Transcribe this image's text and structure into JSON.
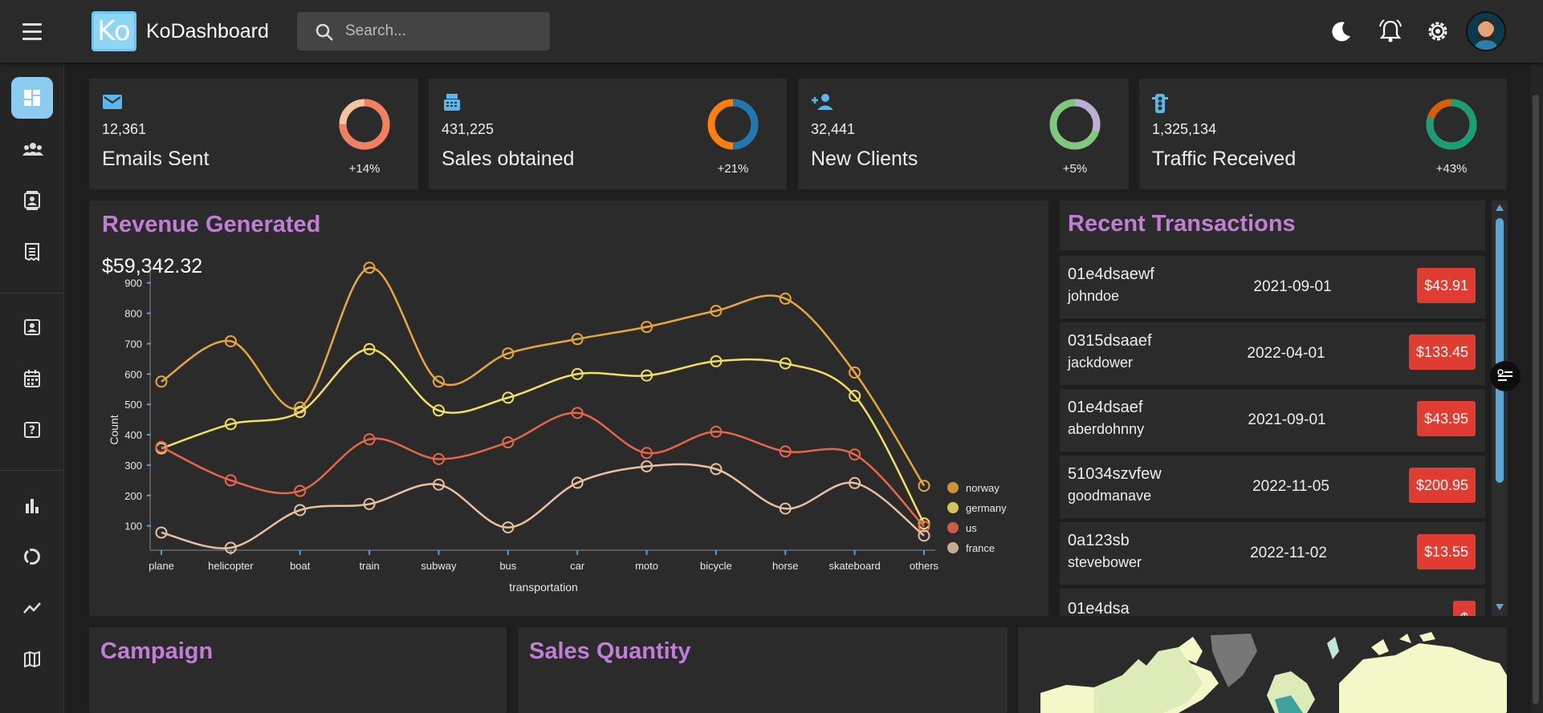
{
  "header": {
    "app_title": "KoDashboard",
    "logo_text": "Ko",
    "search_placeholder": "Search...",
    "icons": [
      "menu-icon",
      "search-icon",
      "moon-icon",
      "bell-icon",
      "gear-icon",
      "avatar"
    ]
  },
  "sidebar": {
    "items": [
      {
        "icon": "dashboard-icon",
        "active": true
      },
      {
        "icon": "team-icon"
      },
      {
        "icon": "contacts-icon"
      },
      {
        "icon": "invoices-icon"
      },
      {
        "icon": "profile-icon"
      },
      {
        "icon": "calendar-icon"
      },
      {
        "icon": "help-icon"
      },
      {
        "icon": "bar-chart-icon"
      },
      {
        "icon": "pie-chart-icon"
      },
      {
        "icon": "line-chart-icon"
      },
      {
        "icon": "map-icon"
      }
    ]
  },
  "stats": [
    {
      "icon": "email-icon",
      "value": "12,361",
      "label": "Emails Sent",
      "increase": "+14%",
      "progress": 0.75,
      "colors": [
        "#f4c6a0",
        "#f08060"
      ]
    },
    {
      "icon": "cash-register-icon",
      "value": "431,225",
      "label": "Sales obtained",
      "increase": "+21%",
      "progress": 0.5,
      "colors": [
        "#ff7f0e",
        "#1f77b4"
      ]
    },
    {
      "icon": "person-add-icon",
      "value": "32,441",
      "label": "New Clients",
      "increase": "+5%",
      "progress": 0.3,
      "colors": [
        "#7fc97f",
        "#beaed4"
      ]
    },
    {
      "icon": "traffic-icon",
      "value": "1,325,134",
      "label": "Traffic Received",
      "increase": "+43%",
      "progress": 0.8,
      "colors": [
        "#d95f02",
        "#1b9e77"
      ]
    }
  ],
  "revenue": {
    "title": "Revenue Generated",
    "amount": "$59,342.32"
  },
  "chart_data": {
    "type": "line",
    "xlabel": "transportation",
    "ylabel": "Count",
    "categories": [
      "plane",
      "helicopter",
      "boat",
      "train",
      "subway",
      "bus",
      "car",
      "moto",
      "bicycle",
      "horse",
      "skateboard",
      "others"
    ],
    "ylim": [
      20,
      960
    ],
    "yticks": [
      100,
      200,
      300,
      400,
      500,
      600,
      700,
      800,
      900
    ],
    "legend": "right",
    "series": [
      {
        "name": "norway",
        "color": "#e8a838",
        "values": [
          575,
          708,
          490,
          950,
          575,
          668,
          715,
          755,
          808,
          848,
          605,
          232
        ]
      },
      {
        "name": "germany",
        "color": "#f1e15b",
        "values": [
          355,
          435,
          475,
          682,
          480,
          522,
          600,
          595,
          642,
          635,
          528,
          108
        ]
      },
      {
        "name": "us",
        "color": "#e8664a",
        "values": [
          360,
          250,
          215,
          385,
          320,
          375,
          472,
          340,
          410,
          345,
          335,
          98
        ]
      },
      {
        "name": "france",
        "color": "#e8c1a0",
        "values": [
          78,
          28,
          152,
          172,
          236,
          95,
          242,
          296,
          287,
          157,
          241,
          68
        ]
      }
    ]
  },
  "transactions": {
    "title": "Recent Transactions",
    "rows": [
      {
        "id": "01e4dsaewf",
        "user": "johndoe",
        "date": "2021-09-01",
        "cost": "$43.91"
      },
      {
        "id": "0315dsaaef",
        "user": "jackdower",
        "date": "2022-04-01",
        "cost": "$133.45"
      },
      {
        "id": "01e4dsaef",
        "user": "aberdohnny",
        "date": "2021-09-01",
        "cost": "$43.95"
      },
      {
        "id": "51034szvfew",
        "user": "goodmanave",
        "date": "2022-11-05",
        "cost": "$200.95"
      },
      {
        "id": "0a123sb",
        "user": "stevebower",
        "date": "2022-11-02",
        "cost": "$13.55"
      },
      {
        "id": "01e4dsa",
        "user": "",
        "date": "",
        "cost": "$"
      }
    ]
  },
  "bottom": {
    "campaign_title": "Campaign",
    "sales_title": "Sales Quantity"
  }
}
